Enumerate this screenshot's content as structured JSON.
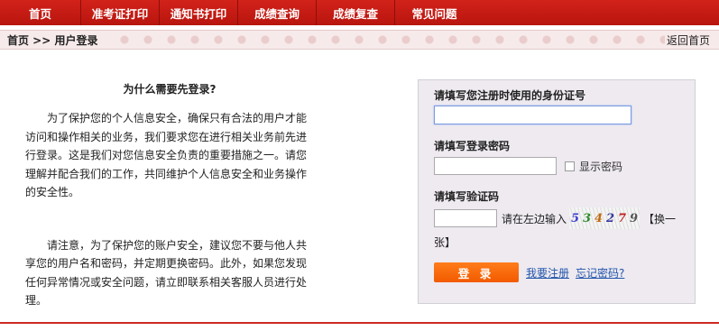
{
  "nav": {
    "items": [
      "首页",
      "准考证打印",
      "通知书打印",
      "成绩查询",
      "成绩复查",
      "常见问题"
    ]
  },
  "breadcrumb": {
    "path": "首页 >> 用户登录",
    "back_home": "返回首页"
  },
  "explain": {
    "title": "为什么需要先登录?",
    "para1": "为了保护您的个人信息安全，确保只有合法的用户才能访问和操作相关的业务，我们要求您在进行相关业务前先进行登录。这是我们对您信息安全负责的重要措施之一。请您理解并配合我们的工作，共同维护个人信息安全和业务操作的安全性。",
    "para2": "请注意，为了保护您的账户安全，建议您不要与他人共享您的用户名和密码，并定期更换密码。此外，如果您发现任何异常情况或安全问题，请立即联系相关客服人员进行处理。"
  },
  "login": {
    "id_label": "请填写您注册时使用的身份证号",
    "id_value": "",
    "password_label": "请填写登录密码",
    "password_value": "",
    "show_password_label": "显示密码",
    "captcha_label": "请填写验证码",
    "captcha_value": "",
    "captcha_hint": "请在左边输入",
    "captcha_chars": [
      "5",
      "3",
      "4",
      "2",
      "7",
      "9"
    ],
    "refresh_captcha_part1": "【换一",
    "refresh_captcha_part2": "张】",
    "login_button": "登 录",
    "register_link": "我要注册",
    "forgot_link": "忘记密码?"
  }
}
